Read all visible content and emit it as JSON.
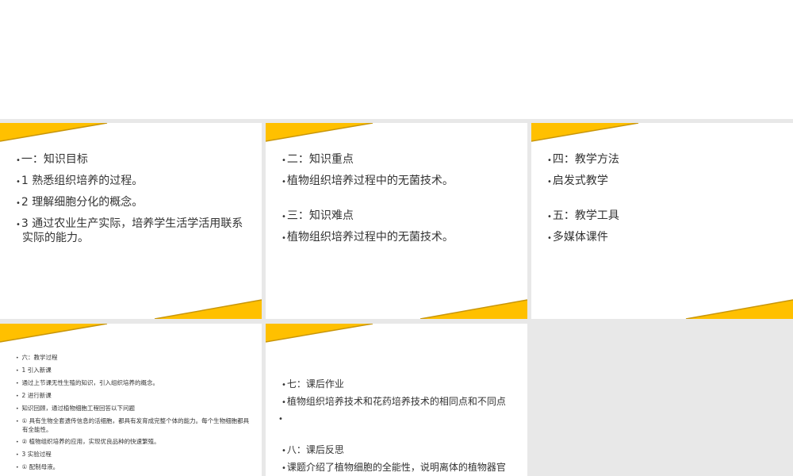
{
  "colors": {
    "accent": "#ffc000",
    "accent_dark": "#c8960a",
    "background": "#e8e8e8"
  },
  "slides": [
    {
      "lines": [
        "一：知识目标",
        "1  熟悉组织培养的过程。",
        "2  理解细胞分化的概念。",
        "3  通过农业生产实际，培养学生活学活用联系实际的能力。"
      ]
    },
    {
      "lines": [
        "二：知识重点",
        "植物组织培养过程中的无菌技术。",
        "三：知识难点",
        "植物组织培养过程中的无菌技术。"
      ]
    },
    {
      "lines": [
        "四：教学方法",
        "启发式教学",
        "五：教学工具",
        "多媒体课件"
      ]
    },
    {
      "lines": [
        "六：教学过程",
        "1  引入新课",
        "通过上节课无性生殖的知识，引入组织培养的概念。",
        "2  进行新课",
        "知识回顾，通过植物细胞工程回答以下问题",
        "① 具有生物全套遗传信息的活细胞，都具有发育成完整个体的能力。每个生物细胞都具有全能性。",
        "②  植物组织培养的应用，实现优良品种的快速繁殖。",
        "3  实验过程",
        "① 配制母液。"
      ]
    },
    {
      "lines": [
        "七：课后作业",
        "植物组织培养技术和花药培养技术的相同点和不同点",
        "",
        "八：课后反思",
        "课题介绍了植物细胞的全能性，说明离体的植物器官"
      ]
    }
  ]
}
